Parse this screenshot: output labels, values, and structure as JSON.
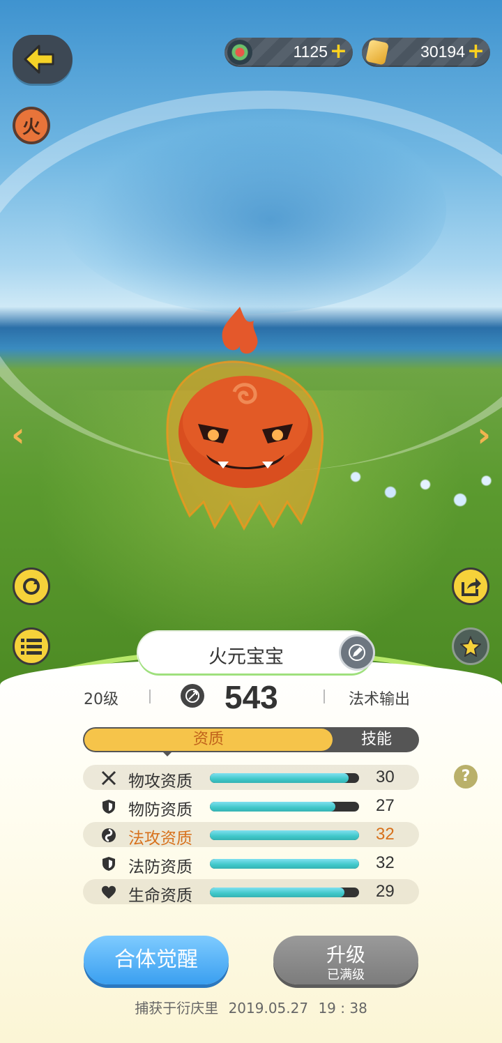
{
  "top": {
    "currency1": {
      "value": "1125",
      "icon": "lotus-gem-icon",
      "plus": "+"
    },
    "currency2": {
      "value": "30194",
      "icon": "gold-crystal-icon",
      "plus": "+"
    }
  },
  "element_badge": "火",
  "pet": {
    "name": "火元宝宝",
    "level": "20级",
    "power": "543",
    "role": "法术输出"
  },
  "tabs": {
    "active": "资质",
    "other": "技能"
  },
  "stats": [
    {
      "label": "物攻资质",
      "value": "30",
      "fill": 0.93,
      "icon": "swords-icon"
    },
    {
      "label": "物防资质",
      "value": "27",
      "fill": 0.84,
      "icon": "shield-icon"
    },
    {
      "label": "法攻资质",
      "value": "32",
      "fill": 1.0,
      "icon": "magic-swirl-icon"
    },
    {
      "label": "法防资质",
      "value": "32",
      "fill": 1.0,
      "icon": "shield-icon"
    },
    {
      "label": "生命资质",
      "value": "29",
      "fill": 0.9,
      "icon": "heart-icon"
    }
  ],
  "help": "?",
  "buttons": {
    "awaken": "合体觉醒",
    "upgrade": "升级",
    "upgrade_sub": "已满级"
  },
  "footer": {
    "place": "捕获于衍庆里",
    "date": "2019.05.27",
    "time": "19 : 38"
  },
  "colors": {
    "accent": "#f6c44a",
    "highlight": "#d7711c",
    "bar": "#3fc7c9"
  }
}
